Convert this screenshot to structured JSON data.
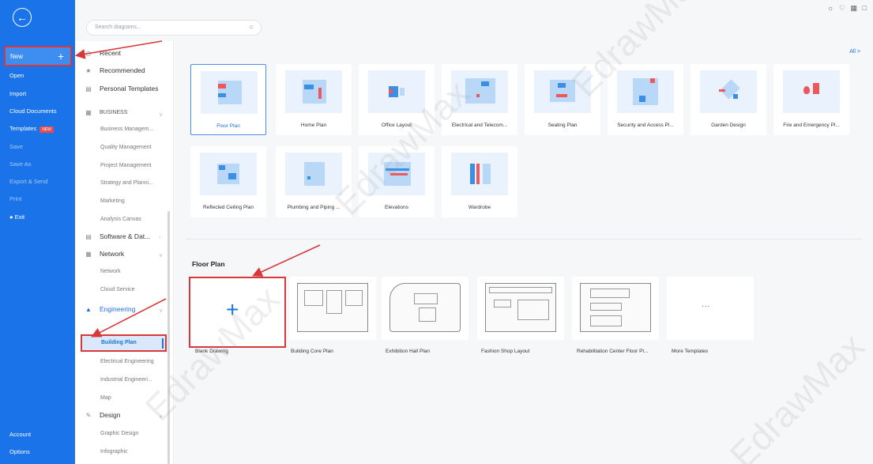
{
  "leftnav": {
    "new_label": "New",
    "items": [
      "Open",
      "Import",
      "Cloud Documents",
      "Templates",
      "Save",
      "Save As",
      "Export & Send",
      "Print",
      "Exit"
    ],
    "templates_badge": "NEW",
    "account": "Account",
    "options": "Options"
  },
  "search": {
    "placeholder": "Search diagrams..."
  },
  "sidebar": {
    "recent": "Recent",
    "recommended": "Recommended",
    "personal": "Personal Templates",
    "business": "Business",
    "business_sub": [
      "Business Managem...",
      "Quality Management",
      "Project Management",
      "Strategy and Planni...",
      "Marketing",
      "Analysis Canvas"
    ],
    "software": "Software & Dat...",
    "network": "Network",
    "network_sub": [
      "Network",
      "Cloud Service"
    ],
    "engineering": "Engineering",
    "engineering_sub": [
      "Building Plan",
      "Electrical Engineering",
      "Industrial Engineeri...",
      "Map"
    ],
    "design": "Design",
    "design_sub": [
      "Graphic Design",
      "Infographic"
    ]
  },
  "main": {
    "all_link": "All >",
    "categories": [
      "Floor Plan",
      "Home Plan",
      "Office Layout",
      "Electrical and Telecom...",
      "Seating Plan",
      "Security and Access Pl...",
      "Garden Design",
      "Fire and Emergency Pl...",
      "Reflected Ceiling Plan",
      "Plumbing and Piping ...",
      "Elevations",
      "Wardrobe"
    ],
    "section_title": "Floor Plan",
    "templates": [
      "Blank Drawing",
      "Building Core Plan",
      "Exhibition Hall Plan",
      "Fashion Shop Layout",
      "Rehabilitation Center Floor Pl...",
      "More Templates"
    ],
    "more_dots": "..."
  },
  "watermark": "EdrawMax",
  "colors": {
    "nav_blue": "#1a73e8",
    "annotation_red": "#d9383a",
    "accent_red": "#f0575b"
  }
}
